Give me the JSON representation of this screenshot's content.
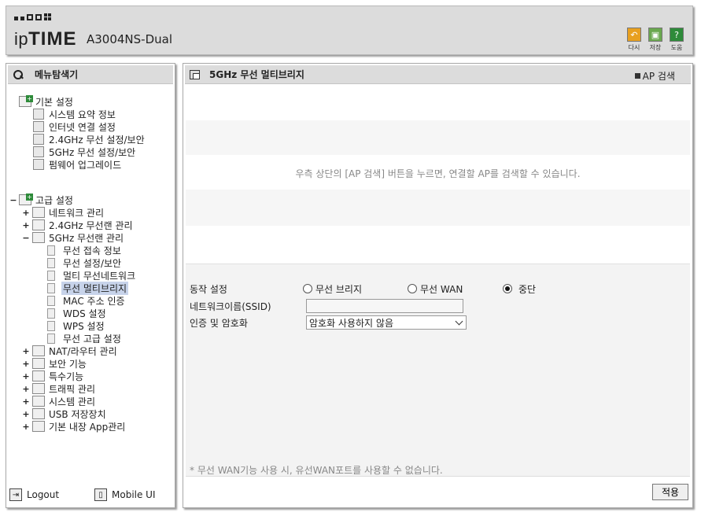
{
  "header": {
    "brand": "ipTIME",
    "model": "A3004NS-Dual",
    "tools": [
      {
        "label": "다시",
        "icon": "undo-icon",
        "color": "#e8a020"
      },
      {
        "label": "저장",
        "icon": "save-icon",
        "color": "#6aa84f"
      },
      {
        "label": "도움",
        "icon": "help-icon",
        "color": "#2e8b3a"
      }
    ]
  },
  "sidebar": {
    "title": "메뉴탐색기",
    "basic": {
      "label": "기본 설정",
      "items": [
        "시스템 요약 정보",
        "인터넷 연결 설정",
        "2.4GHz 무선 설정/보안",
        "5GHz 무선 설정/보안",
        "펌웨어 업그레이드"
      ]
    },
    "advanced": {
      "label": "고급 설정",
      "groups": [
        {
          "label": "네트워크 관리",
          "exp": "+"
        },
        {
          "label": "2.4GHz 무선랜 관리",
          "exp": "+"
        },
        {
          "label": "5GHz 무선랜 관리",
          "exp": "−"
        }
      ],
      "sub_items": [
        "무선 접속 정보",
        "무선 설정/보안",
        "멀티 무선네트워크",
        "무선 멀티브리지",
        "MAC 주소 인증",
        "WDS 설정",
        "WPS 설정",
        "무선 고급 설정"
      ],
      "selected": "무선 멀티브리지",
      "groups2": [
        "NAT/라우터 관리",
        "보안 기능",
        "특수기능",
        "트래픽 관리",
        "시스템 관리",
        "USB 저장장치",
        "기본 내장 App관리"
      ]
    },
    "footer": {
      "logout": "Logout",
      "mobile": "Mobile UI"
    }
  },
  "main": {
    "title": "5GHz 무선 멀티브리지",
    "ap_search": "AP 검색",
    "scan_message": "우측 상단의 [AP 검색] 버튼을 누르면, 연결할 AP를 검색할 수 있습니다.",
    "mode_label": "동작 설정",
    "modes": [
      "무선 브리지",
      "무선 WAN",
      "중단"
    ],
    "selected_mode": "중단",
    "ssid_label": "네트워크이름(SSID)",
    "ssid_value": "",
    "auth_label": "인증 및 암호화",
    "auth_value": "암호화 사용하지 않음",
    "note": "* 무선 WAN기능 사용 시, 유선WAN포트를 사용할 수 없습니다.",
    "apply": "적용"
  }
}
